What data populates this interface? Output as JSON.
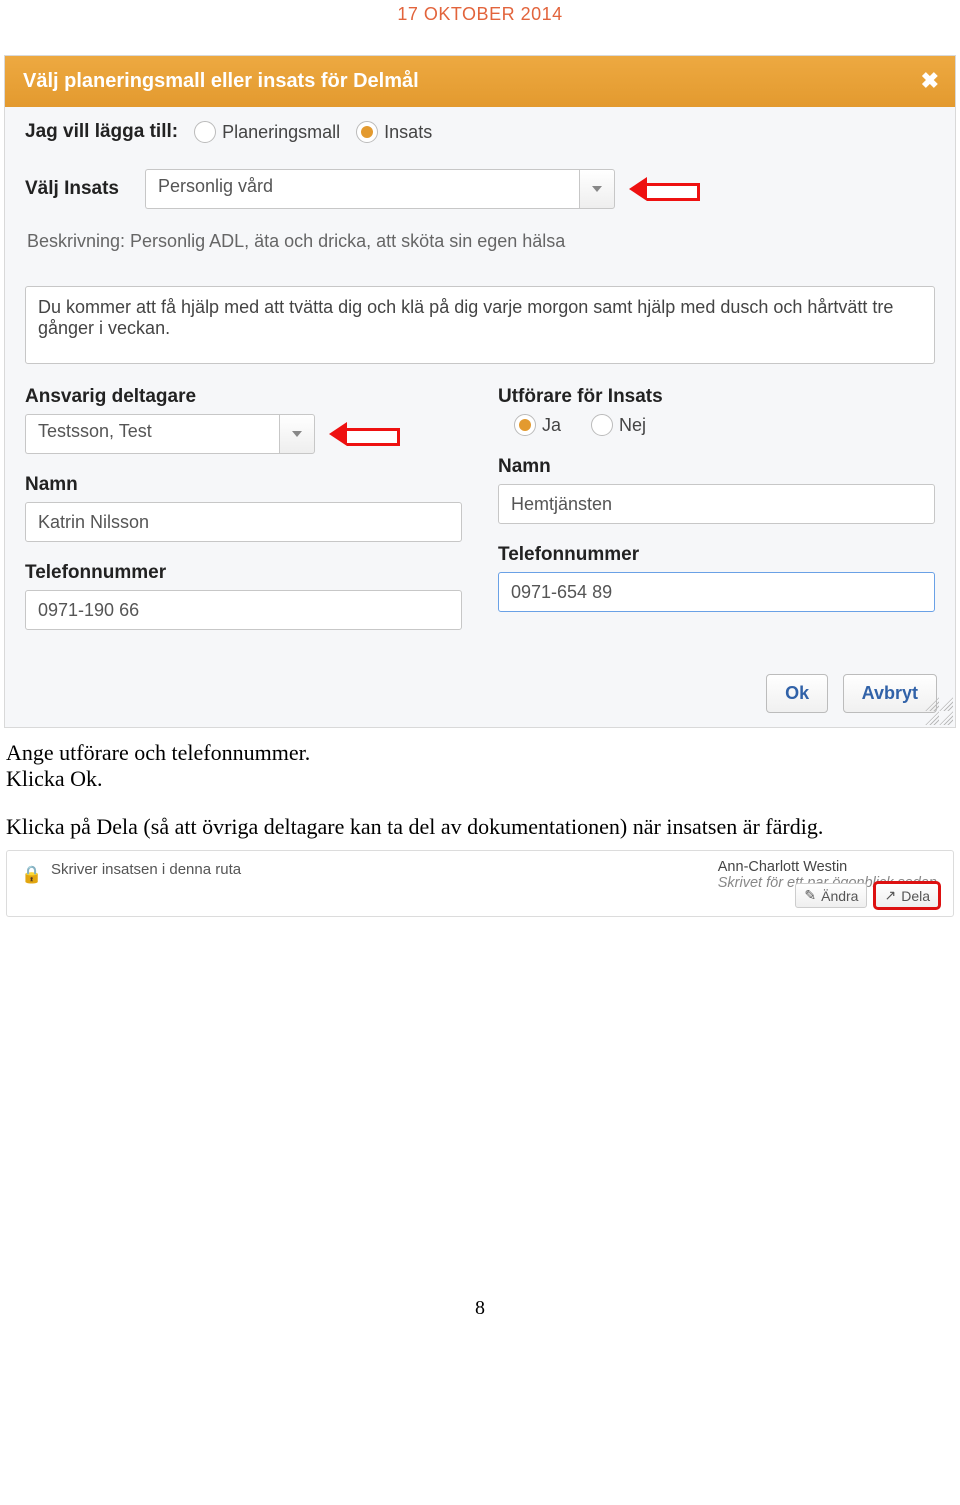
{
  "doc_header": "17 OKTOBER 2014",
  "dialog": {
    "title": "Välj planeringsmall eller insats för Delmål",
    "close": "✖",
    "add_row_label": "Jag vill lägga till:",
    "option_template": "Planeringsmall",
    "option_insats": "Insats",
    "insats_label": "Välj Insats",
    "insats_value": "Personlig vård",
    "description": "Beskrivning: Personlig ADL, äta och dricka, att sköta sin egen hälsa",
    "details_text": "Du kommer att få hjälp med att tvätta dig och klä på dig varje morgon samt hjälp med dusch och hårtvätt tre gånger i veckan.",
    "left": {
      "participant_label": "Ansvarig deltagare",
      "participant_value": "Testsson, Test",
      "name_label": "Namn",
      "name_value": "Katrin Nilsson",
      "phone_label": "Telefonnummer",
      "phone_value": "0971-190 66"
    },
    "right": {
      "performer_label": "Utförare för Insats",
      "yes": "Ja",
      "no": "Nej",
      "name_label": "Namn",
      "name_value": "Hemtjänsten",
      "phone_label": "Telefonnummer",
      "phone_value": "0971-654 89"
    },
    "ok": "Ok",
    "cancel": "Avbryt"
  },
  "instructions": {
    "line1": "Ange utförare och telefonnummer.",
    "line2": "Klicka Ok.",
    "line3": "Klicka på Dela (så att övriga deltagare kan ta del av dokumentationen) när insatsen är färdig."
  },
  "note": {
    "text": "Skriver insatsen i denna ruta",
    "author": "Ann-Charlott Westin",
    "when": "Skrivet för ett par ögonblick sedan",
    "edit": "Ändra",
    "share": "Dela"
  },
  "page_number": "8"
}
